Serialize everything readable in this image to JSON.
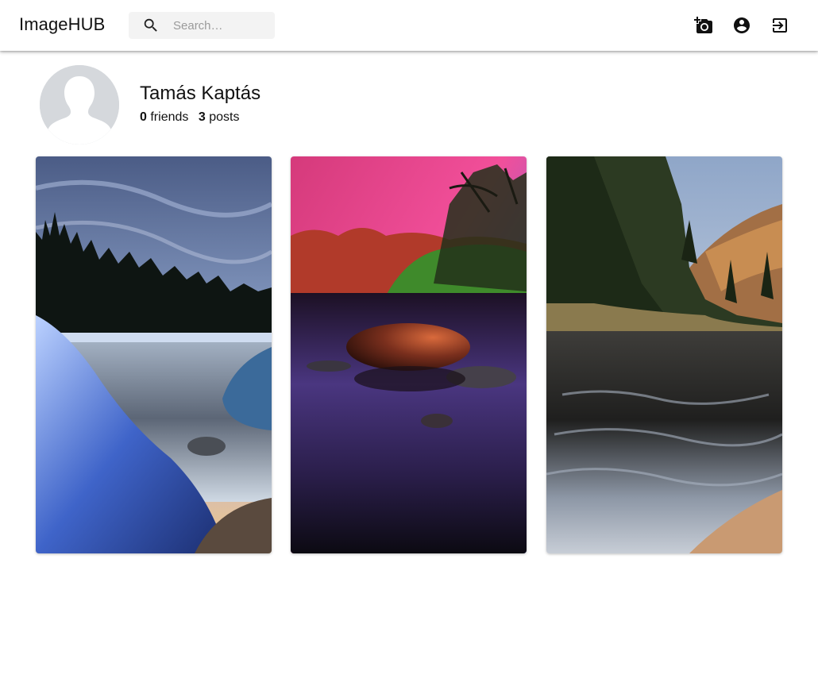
{
  "app": {
    "title": "ImageHUB"
  },
  "search": {
    "placeholder": "Search…",
    "value": ""
  },
  "toolbar": {
    "icons": [
      "add-photo-icon",
      "account-circle-icon",
      "logout-icon"
    ]
  },
  "profile": {
    "name": "Tamás Kaptás",
    "friends_count": "0",
    "friends_label": "friends",
    "posts_count": "3",
    "posts_label": "posts"
  },
  "posts": [
    {
      "subject": "frosty-lake-photo"
    },
    {
      "subject": "sunset-lake-rocks-photo"
    },
    {
      "subject": "autumn-river-photo"
    }
  ],
  "colors": {
    "appbar_bg": "#ffffff",
    "search_bg": "#f3f3f3",
    "avatar_bg": "#d5d8dc",
    "text": "#111111"
  }
}
